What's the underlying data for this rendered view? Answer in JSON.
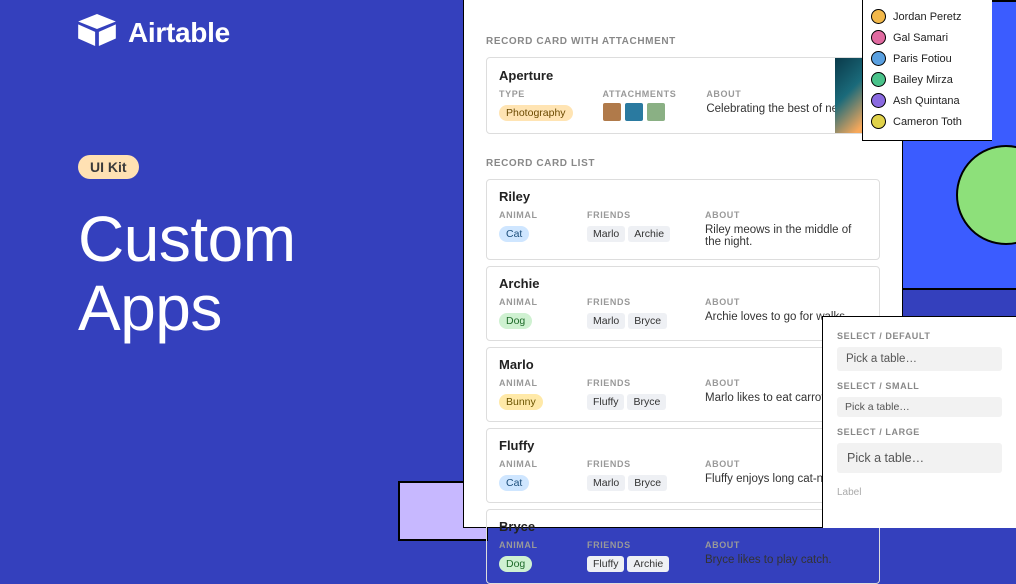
{
  "brand": {
    "name": "Airtable"
  },
  "badge": "UI Kit",
  "headline": "Custom\nApps",
  "panel": {
    "section_attachment": "RECORD CARD WITH ATTACHMENT",
    "attachment_card": {
      "title": "Aperture",
      "type_label": "TYPE",
      "type_value": "Photography",
      "type_color": "orange",
      "attachments_label": "ATTACHMENTS",
      "about_label": "ABOUT",
      "about_value": "Celebrating the best of new…",
      "thumbs": [
        "#b07a4a",
        "#2a7aa0",
        "#8ab084"
      ]
    },
    "section_list": "RECORD CARD LIST",
    "animal_label": "ANIMAL",
    "friends_label": "FRIENDS",
    "about_label": "ABOUT",
    "records": [
      {
        "name": "Riley",
        "animal": "Cat",
        "animal_color": "blue",
        "friends": [
          "Marlo",
          "Archie"
        ],
        "about": "Riley meows in the middle of the night."
      },
      {
        "name": "Archie",
        "animal": "Dog",
        "animal_color": "green",
        "friends": [
          "Marlo",
          "Bryce"
        ],
        "about": "Archie loves to go for walks."
      },
      {
        "name": "Marlo",
        "animal": "Bunny",
        "animal_color": "yellow",
        "friends": [
          "Fluffy",
          "Bryce"
        ],
        "about": "Marlo likes to eat carrots."
      },
      {
        "name": "Fluffy",
        "animal": "Cat",
        "animal_color": "blue",
        "friends": [
          "Marlo",
          "Bryce"
        ],
        "about": "Fluffy enjoys long cat-naps."
      },
      {
        "name": "Bryce",
        "animal": "Dog",
        "animal_color": "green",
        "friends": [
          "Fluffy",
          "Archie"
        ],
        "about": "Bryce likes to play catch."
      }
    ]
  },
  "people": [
    {
      "name": "Jordan Peretz",
      "color": "#f2b84a"
    },
    {
      "name": "Gal Samari",
      "color": "#e06aa0"
    },
    {
      "name": "Paris Fotiou",
      "color": "#5aa0e0"
    },
    {
      "name": "Bailey Mirza",
      "color": "#4ac28a"
    },
    {
      "name": "Ash Quintana",
      "color": "#8a6ae0"
    },
    {
      "name": "Cameron Toth",
      "color": "#e0d24a"
    }
  ],
  "selects": {
    "default_label": "SELECT / DEFAULT",
    "small_label": "SELECT / SMALL",
    "large_label": "SELECT / LARGE",
    "placeholder": "Pick a table…",
    "footer": "Label"
  }
}
